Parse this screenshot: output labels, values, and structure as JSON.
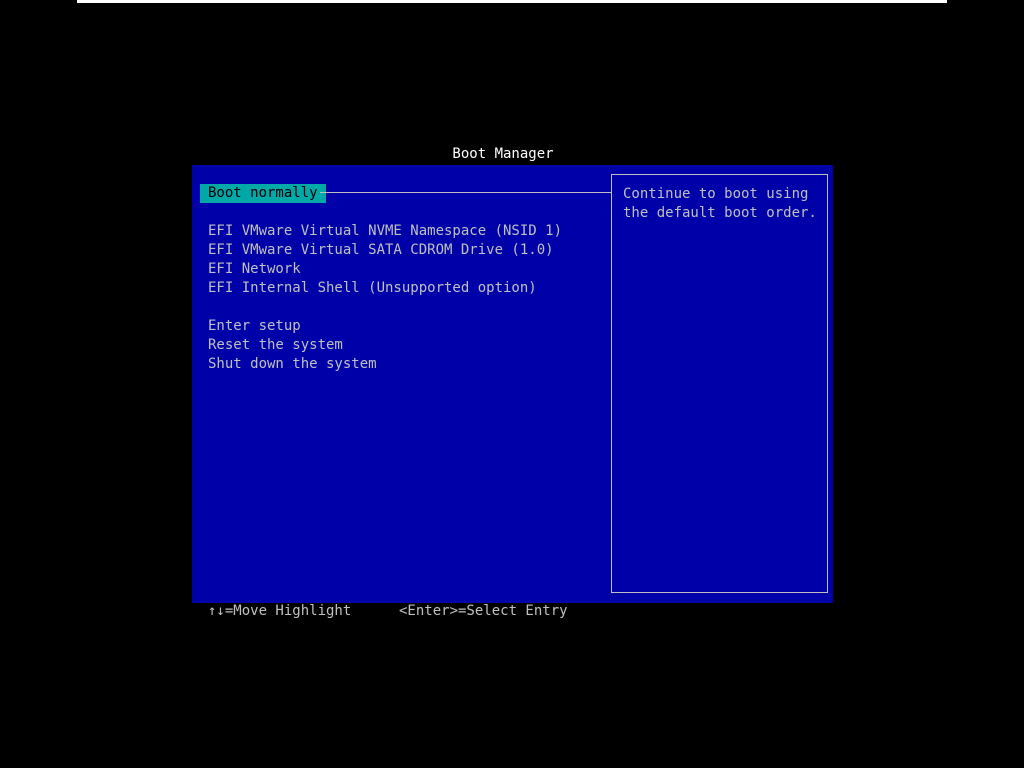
{
  "title": "Boot Manager",
  "menu": {
    "selected": "Boot normally",
    "boot_entries": [
      "EFI VMware Virtual NVME Namespace (NSID 1)",
      "EFI VMware Virtual SATA CDROM Drive (1.0)",
      "EFI Network",
      "EFI Internal Shell (Unsupported option)"
    ],
    "actions": [
      "Enter setup",
      "Reset the system",
      "Shut down the system"
    ]
  },
  "help": {
    "text": "Continue to boot using\nthe default boot order."
  },
  "footer": {
    "move_hint": "↑↓=Move Highlight",
    "select_hint": "<Enter>=Select Entry"
  },
  "colors": {
    "background": "#000000",
    "panel": "#0000a8",
    "highlight": "#00a8a8",
    "text": "#c0c0c0",
    "title": "#ffffff"
  }
}
